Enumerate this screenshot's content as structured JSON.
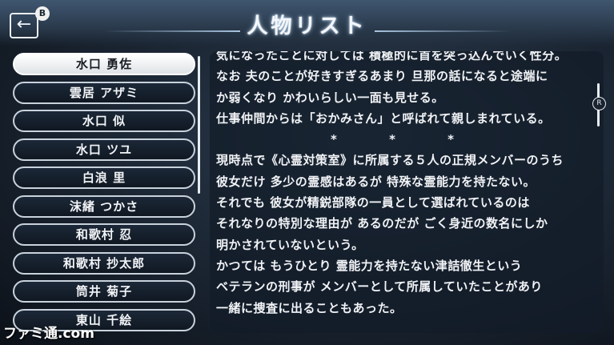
{
  "header": {
    "title": "人物リスト",
    "back_icon": "←",
    "b_button": "B"
  },
  "characters": [
    {
      "name": "水口 勇佐",
      "selected": true
    },
    {
      "name": "雲居 アザミ"
    },
    {
      "name": "水口 似"
    },
    {
      "name": "水口 ツユ"
    },
    {
      "name": "白浪 里"
    },
    {
      "name": "沫緒 つかさ"
    },
    {
      "name": "和歌村 忍"
    },
    {
      "name": "和歌村 抄太郎"
    },
    {
      "name": "筒井 菊子"
    },
    {
      "name": "東山 千絵"
    }
  ],
  "description": {
    "lines": [
      "気になったことに対しては 積極的に首を突っ込んでいく性分。",
      "なお 夫のことが好きすぎるあまり 旦那の話になると途端に",
      "か弱くなり かわいらしい一面も見せる。",
      "仕事仲間からは「おかみさん」と呼ばれて親しまれている。",
      "* * *",
      "現時点で《心霊対策室》に所属する５人の正規メンバーのうち",
      "彼女だけ 多少の霊感はあるが 特殊な霊能力を持たない。",
      "それでも 彼女が精鋭部隊の一員として選ばれているのは",
      "それなりの特別な理由が あるのだが ごく身近の数名にしか",
      "明かされていないという。",
      "かつては もうひとり 霊能力を持たない津詰徹生という",
      "ベテランの刑事が メンバーとして所属していたことがあり",
      "一緒に捜査に出ることもあった。"
    ]
  },
  "scroll_badge": "R",
  "watermark": "ファミ通.com"
}
